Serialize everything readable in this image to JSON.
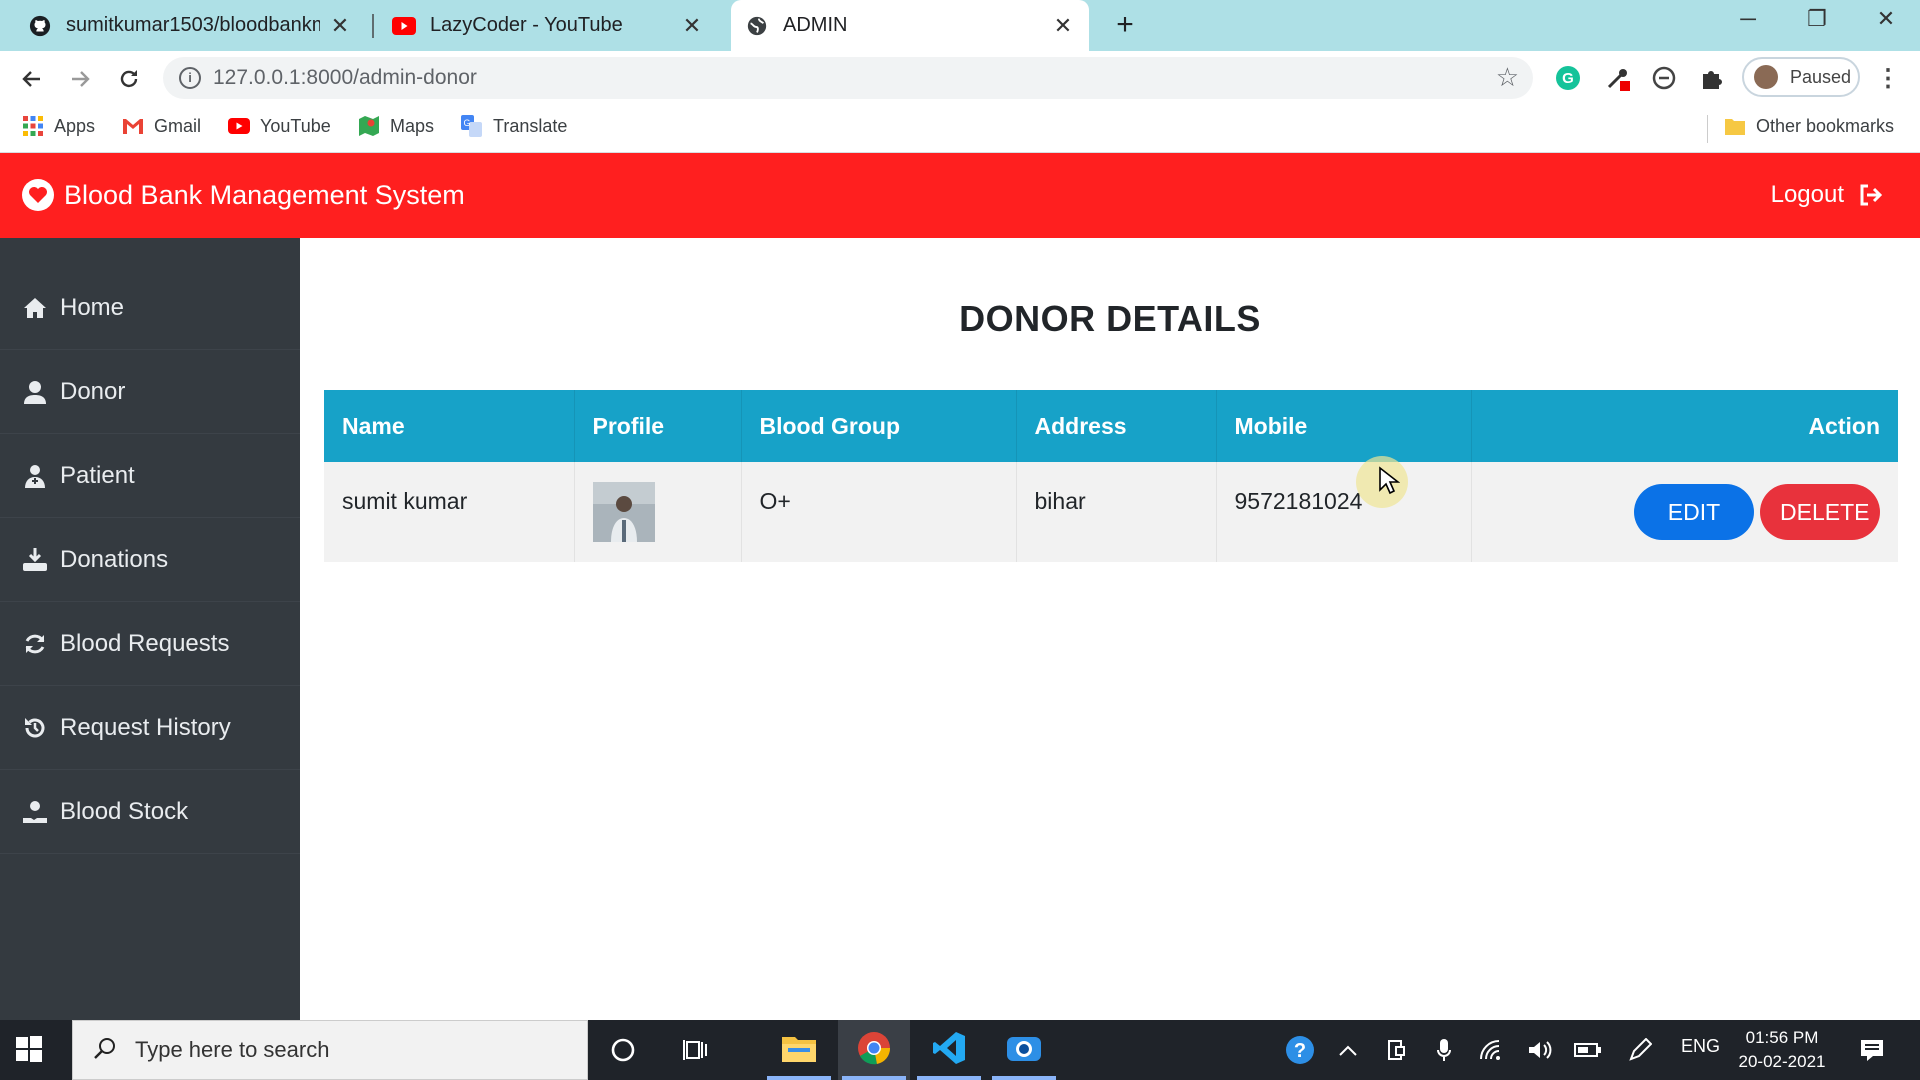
{
  "browser": {
    "tabs": [
      {
        "title": "sumitkumar1503/bloodbankman",
        "icon": "github-icon",
        "active": false
      },
      {
        "title": "LazyCoder - YouTube",
        "icon": "youtube-icon",
        "active": false
      },
      {
        "title": "ADMIN",
        "icon": "globe-icon",
        "active": true
      }
    ],
    "address": "127.0.0.1:8000/admin-donor",
    "profile_label": "Paused",
    "bookmarks": [
      "Apps",
      "Gmail",
      "YouTube",
      "Maps",
      "Translate"
    ],
    "other_bookmarks": "Other bookmarks"
  },
  "app": {
    "brand": "Blood Bank Management System",
    "logout": "Logout",
    "accent": "#ff1f1f",
    "sidebar": [
      {
        "label": "Home",
        "icon": "home-icon"
      },
      {
        "label": "Donor",
        "icon": "user-icon"
      },
      {
        "label": "Patient",
        "icon": "patient-icon"
      },
      {
        "label": "Donations",
        "icon": "donation-icon"
      },
      {
        "label": "Blood Requests",
        "icon": "refresh-icon"
      },
      {
        "label": "Request History",
        "icon": "history-icon"
      },
      {
        "label": "Blood Stock",
        "icon": "stock-icon"
      }
    ]
  },
  "main": {
    "title": "DONOR DETAILS",
    "columns": [
      "Name",
      "Profile",
      "Blood Group",
      "Address",
      "Mobile",
      "Action"
    ],
    "rows": [
      {
        "name": "sumit kumar",
        "blood_group": "O+",
        "address": "bihar",
        "mobile": "9572181024"
      }
    ],
    "edit_label": "EDIT",
    "delete_label": "DELETE"
  },
  "taskbar": {
    "search_placeholder": "Type here to search",
    "language": "ENG",
    "time": "01:56 PM",
    "date": "20-02-2021"
  }
}
